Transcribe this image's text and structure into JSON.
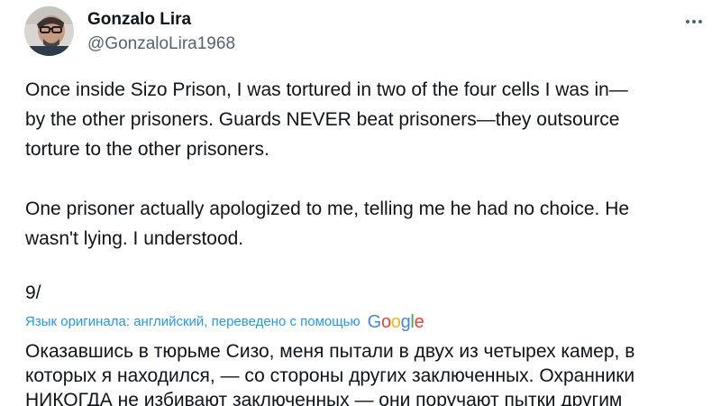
{
  "author": {
    "display_name": "Gonzalo Lira",
    "handle": "@GonzaloLira1968"
  },
  "icons": {
    "more": "more-horizontal-icon",
    "avatar": "profile-photo"
  },
  "tweet": {
    "paragraph_1": "Once inside Sizo Prison, I was tortured in two of the four cells I was in—\nby the other prisoners. Guards NEVER beat prisoners—they outsource\ntorture to the other prisoners.",
    "paragraph_2": "One prisoner actually apologized to me, telling me he had no choice. He\nwasn't lying. I understood.",
    "thread_number": "9/"
  },
  "translation": {
    "notice": "Язык оригинала: английский, переведено с помощью",
    "provider": "Google",
    "text": "Оказавшись в тюрьме Сизо, меня пытали в двух из четырех камер, в\nкоторых я находился, — со стороны других заключенных. Охранники\nНИКОГДА не избивают заключенных — они поручают пытки другим"
  },
  "colors": {
    "text": "#0f1419",
    "secondary": "#536471",
    "link": "#1d9bf0",
    "google_blue": "#4285f4",
    "google_red": "#ea4335",
    "google_yellow": "#fbbc05",
    "google_green": "#34a853"
  }
}
